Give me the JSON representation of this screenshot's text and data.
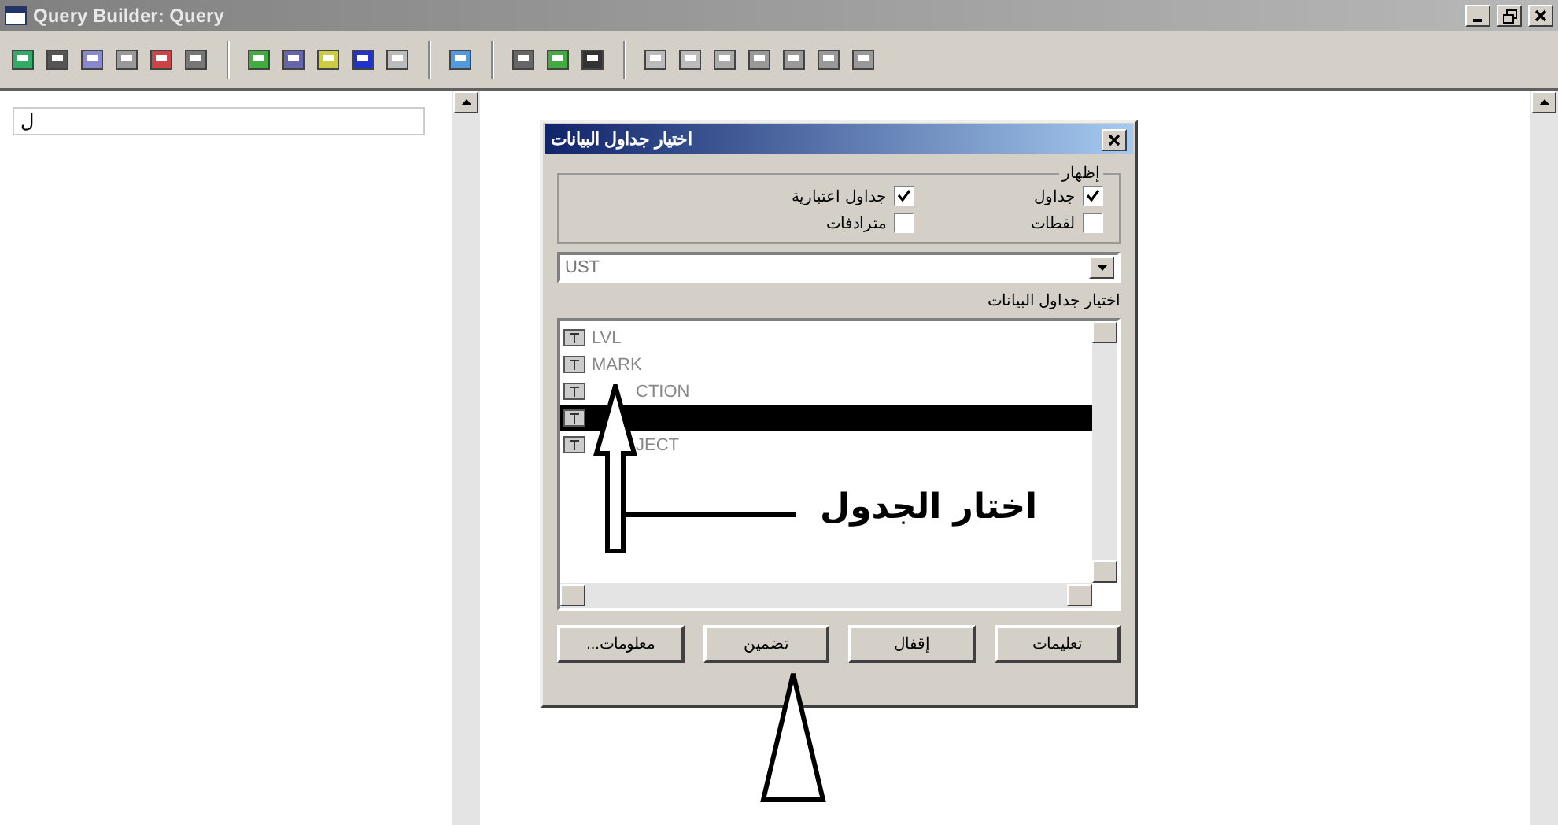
{
  "window": {
    "title": "Query Builder: Query"
  },
  "left_pane": {
    "field_value": "ل"
  },
  "dialog": {
    "title": "اختيار جداول البيانات",
    "show_group": {
      "label": "إظهار",
      "options": [
        {
          "label": "جداول",
          "checked": true
        },
        {
          "label": "جداول اعتبارية",
          "checked": true
        },
        {
          "label": "لقطات",
          "checked": false
        },
        {
          "label": "مترادفات",
          "checked": false
        }
      ]
    },
    "owner": {
      "value": "UST"
    },
    "list_label": "اختيار جداول البيانات",
    "tables": [
      {
        "name": "LVL",
        "selected": false
      },
      {
        "name": "MARK",
        "selected": false
      },
      {
        "name": "CTION",
        "kind": "partly_hidden",
        "selected": false
      },
      {
        "selected": true
      },
      {
        "name": "JECT",
        "kind": "partly_hidden",
        "selected": false
      }
    ],
    "buttons": [
      "تعليمات",
      "إقفال",
      "تضمين",
      "معلومات..."
    ]
  },
  "annotation": {
    "text": "اختار الجدول"
  }
}
